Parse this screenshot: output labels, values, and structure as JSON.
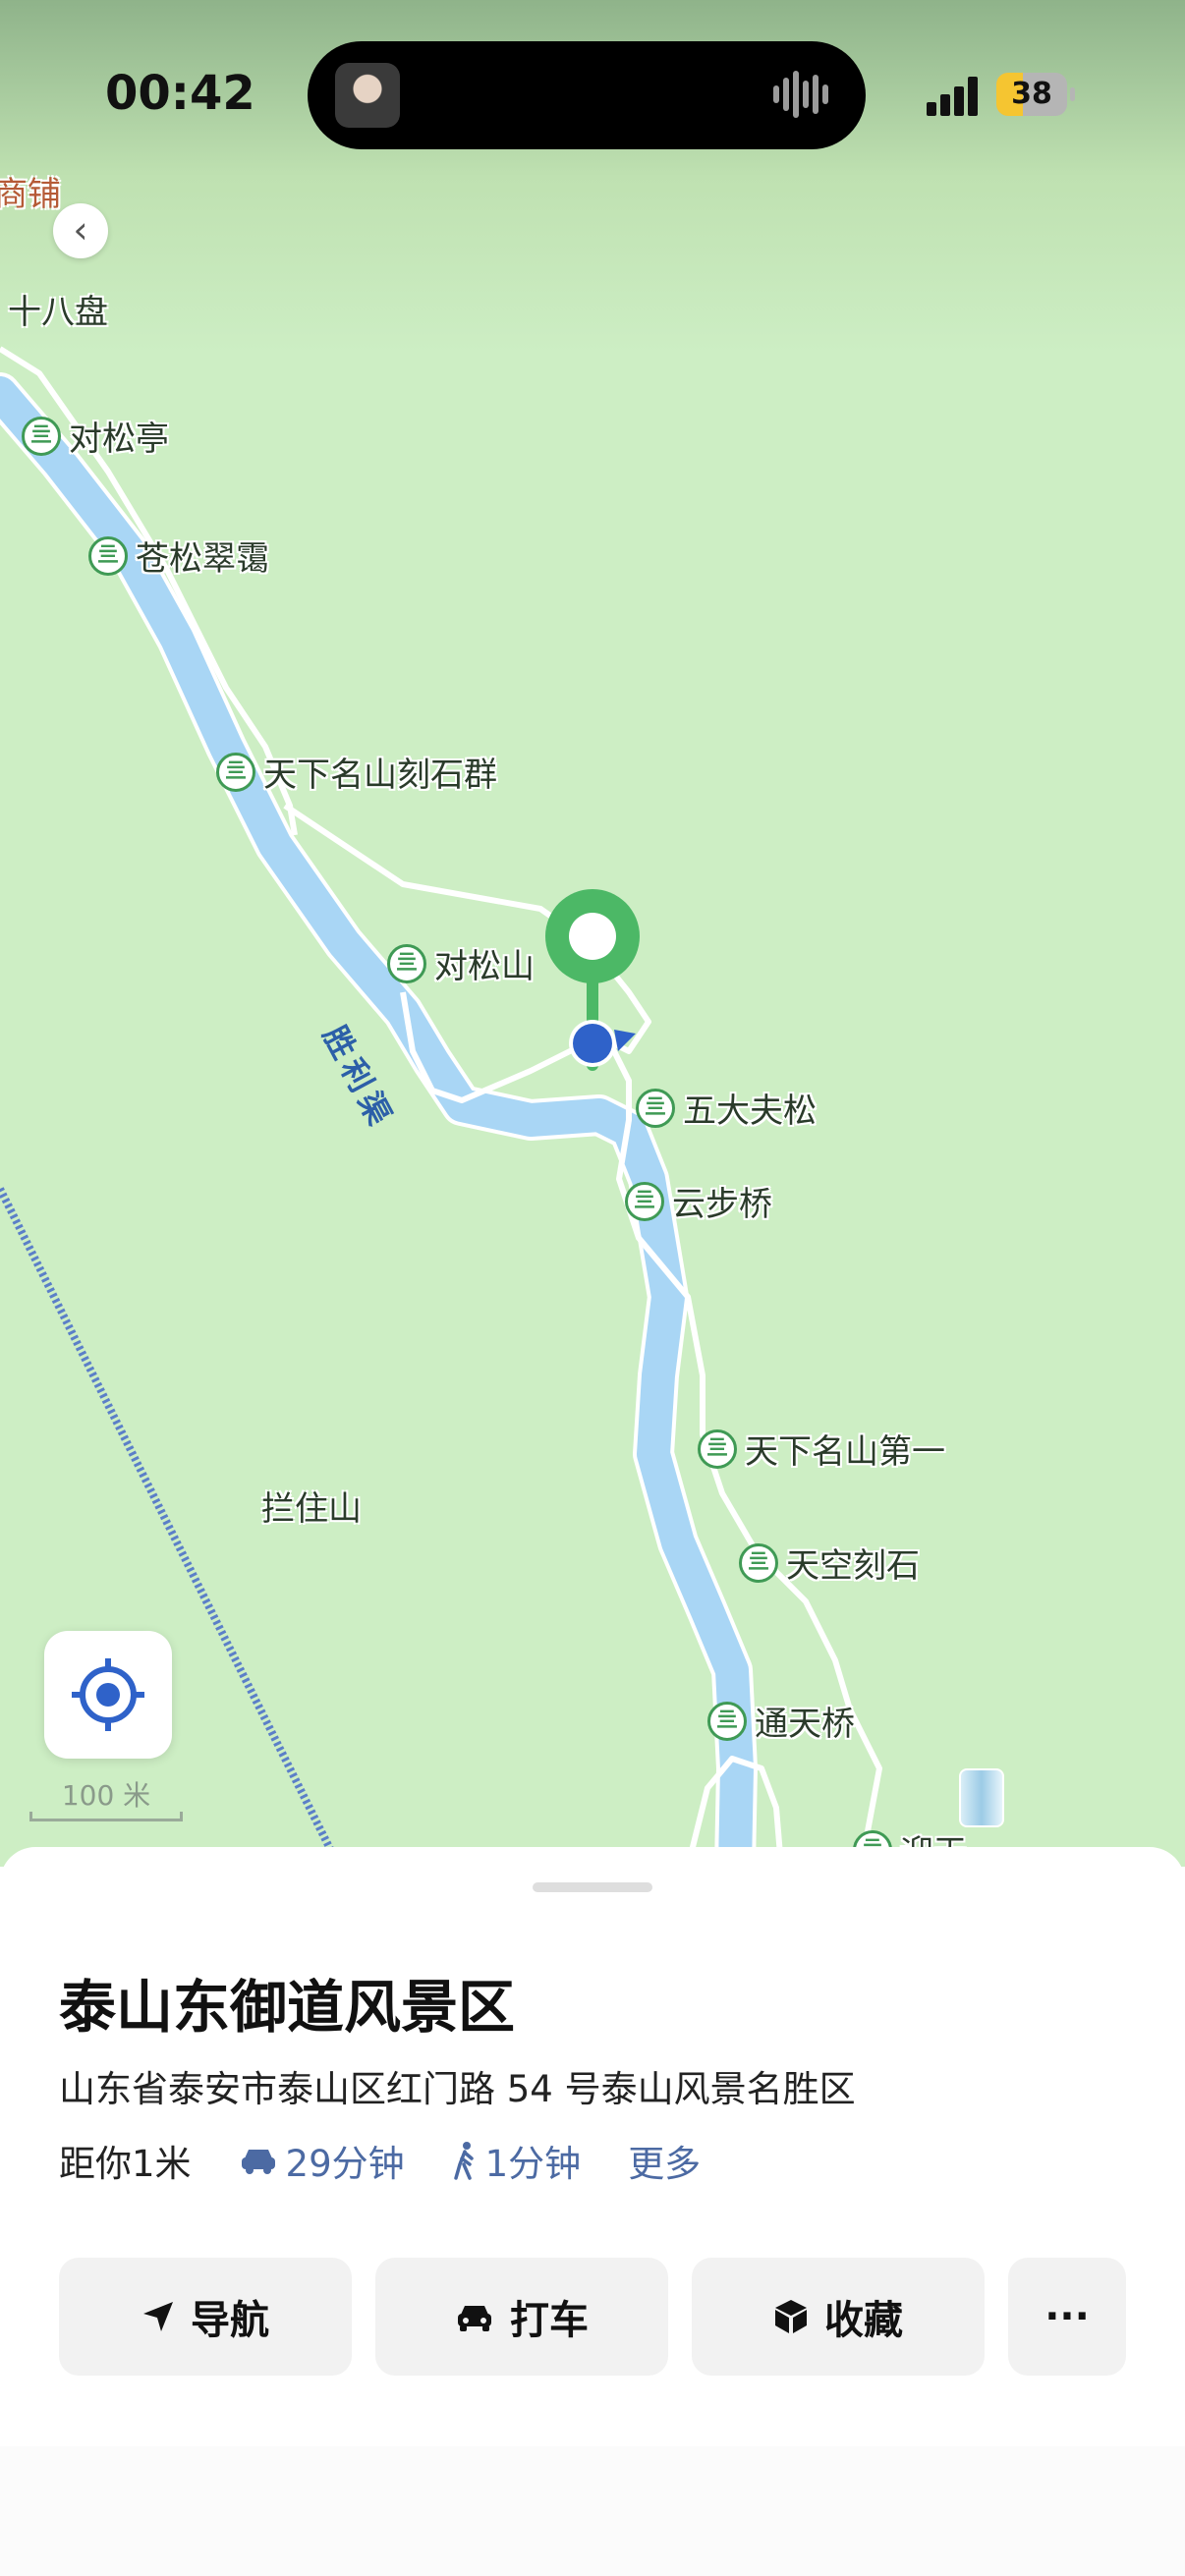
{
  "status_bar": {
    "time": "00:42",
    "battery": "38"
  },
  "map": {
    "shop_label": "商铺",
    "area_label": "十八盘",
    "river_label": "胜利渠",
    "mountain_label": "拦住山",
    "pois": [
      {
        "name": "对松亭"
      },
      {
        "name": "苍松翠霭"
      },
      {
        "name": "天下名山刻石群"
      },
      {
        "name": "对松山"
      },
      {
        "name": "五大夫松"
      },
      {
        "name": "云步桥"
      },
      {
        "name": "天下名山第一"
      },
      {
        "name": "天空刻石"
      },
      {
        "name": "通天桥"
      },
      {
        "name": "迎天"
      }
    ],
    "poi_icon_glyph": "亖",
    "scale_text": "100 米",
    "colors": {
      "marker": "#4cb866",
      "location_dot": "#2f62c9",
      "river": "#a9d6f5",
      "land": "#cdeec4"
    }
  },
  "place": {
    "title": "泰山东御道风景区",
    "address": "山东省泰安市泰山区红门路 54 号泰山风景名胜区",
    "distance": "距你1米",
    "drive_time": "29分钟",
    "walk_time": "1分钟",
    "more": "更多"
  },
  "actions": {
    "navigate": "导航",
    "taxi": "打车",
    "favorite": "收藏",
    "more": "···"
  }
}
